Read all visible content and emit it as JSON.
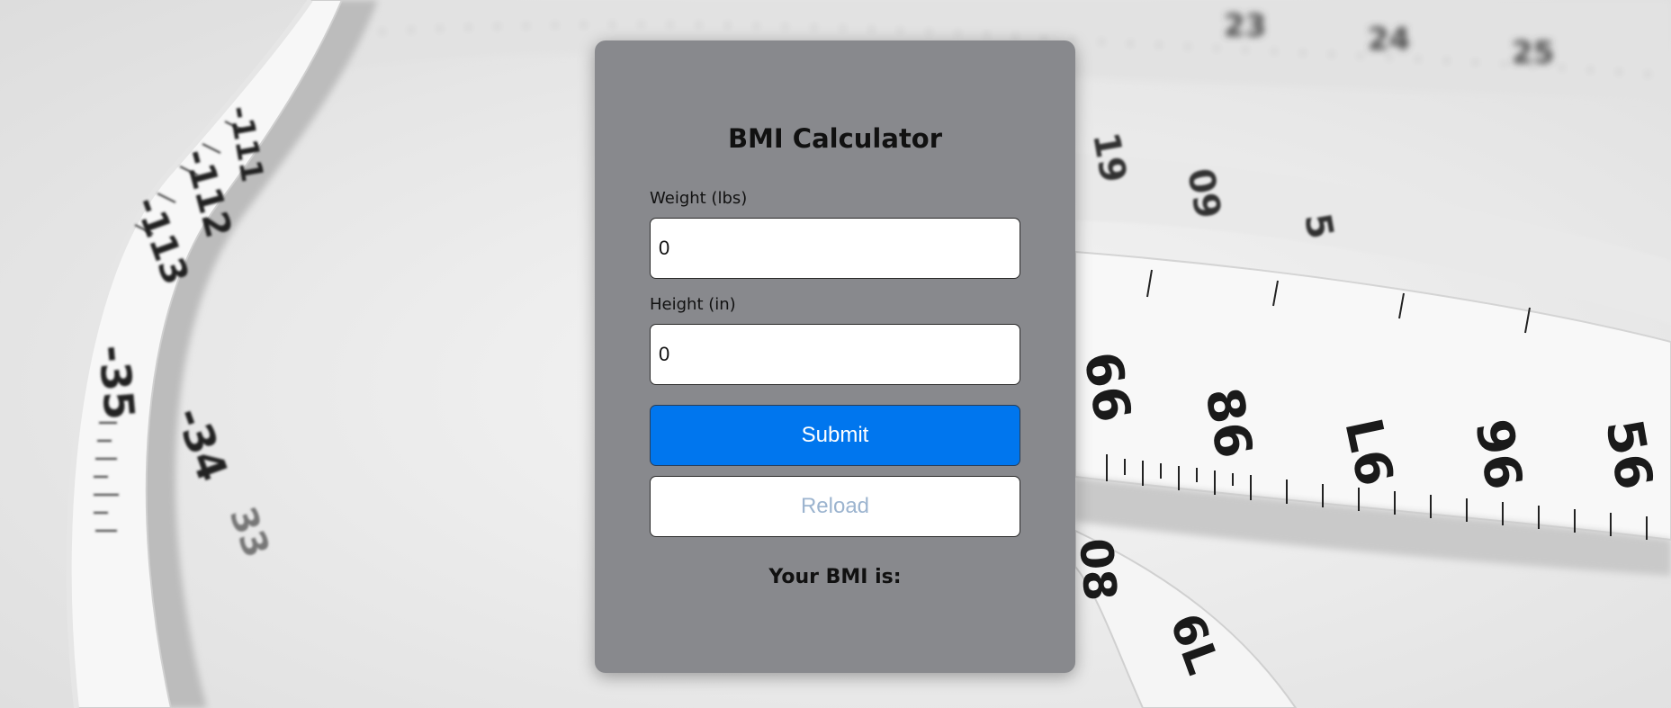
{
  "form": {
    "title": "BMI Calculator",
    "weight_label": "Weight (lbs)",
    "weight_value": "0",
    "height_label": "Height (in)",
    "height_value": "0",
    "submit_label": "Submit",
    "reload_label": "Reload",
    "result_label": "Your BMI is:"
  },
  "background": {
    "tape_numbers": [
      "111",
      "112",
      "113",
      "35",
      "34",
      "33",
      "61",
      "60",
      "5",
      "99",
      "98",
      "97",
      "96",
      "95",
      "80",
      "79"
    ]
  },
  "colors": {
    "card": "#88898d",
    "submit": "#0076ee",
    "reload_text": "#9cb4cf"
  }
}
